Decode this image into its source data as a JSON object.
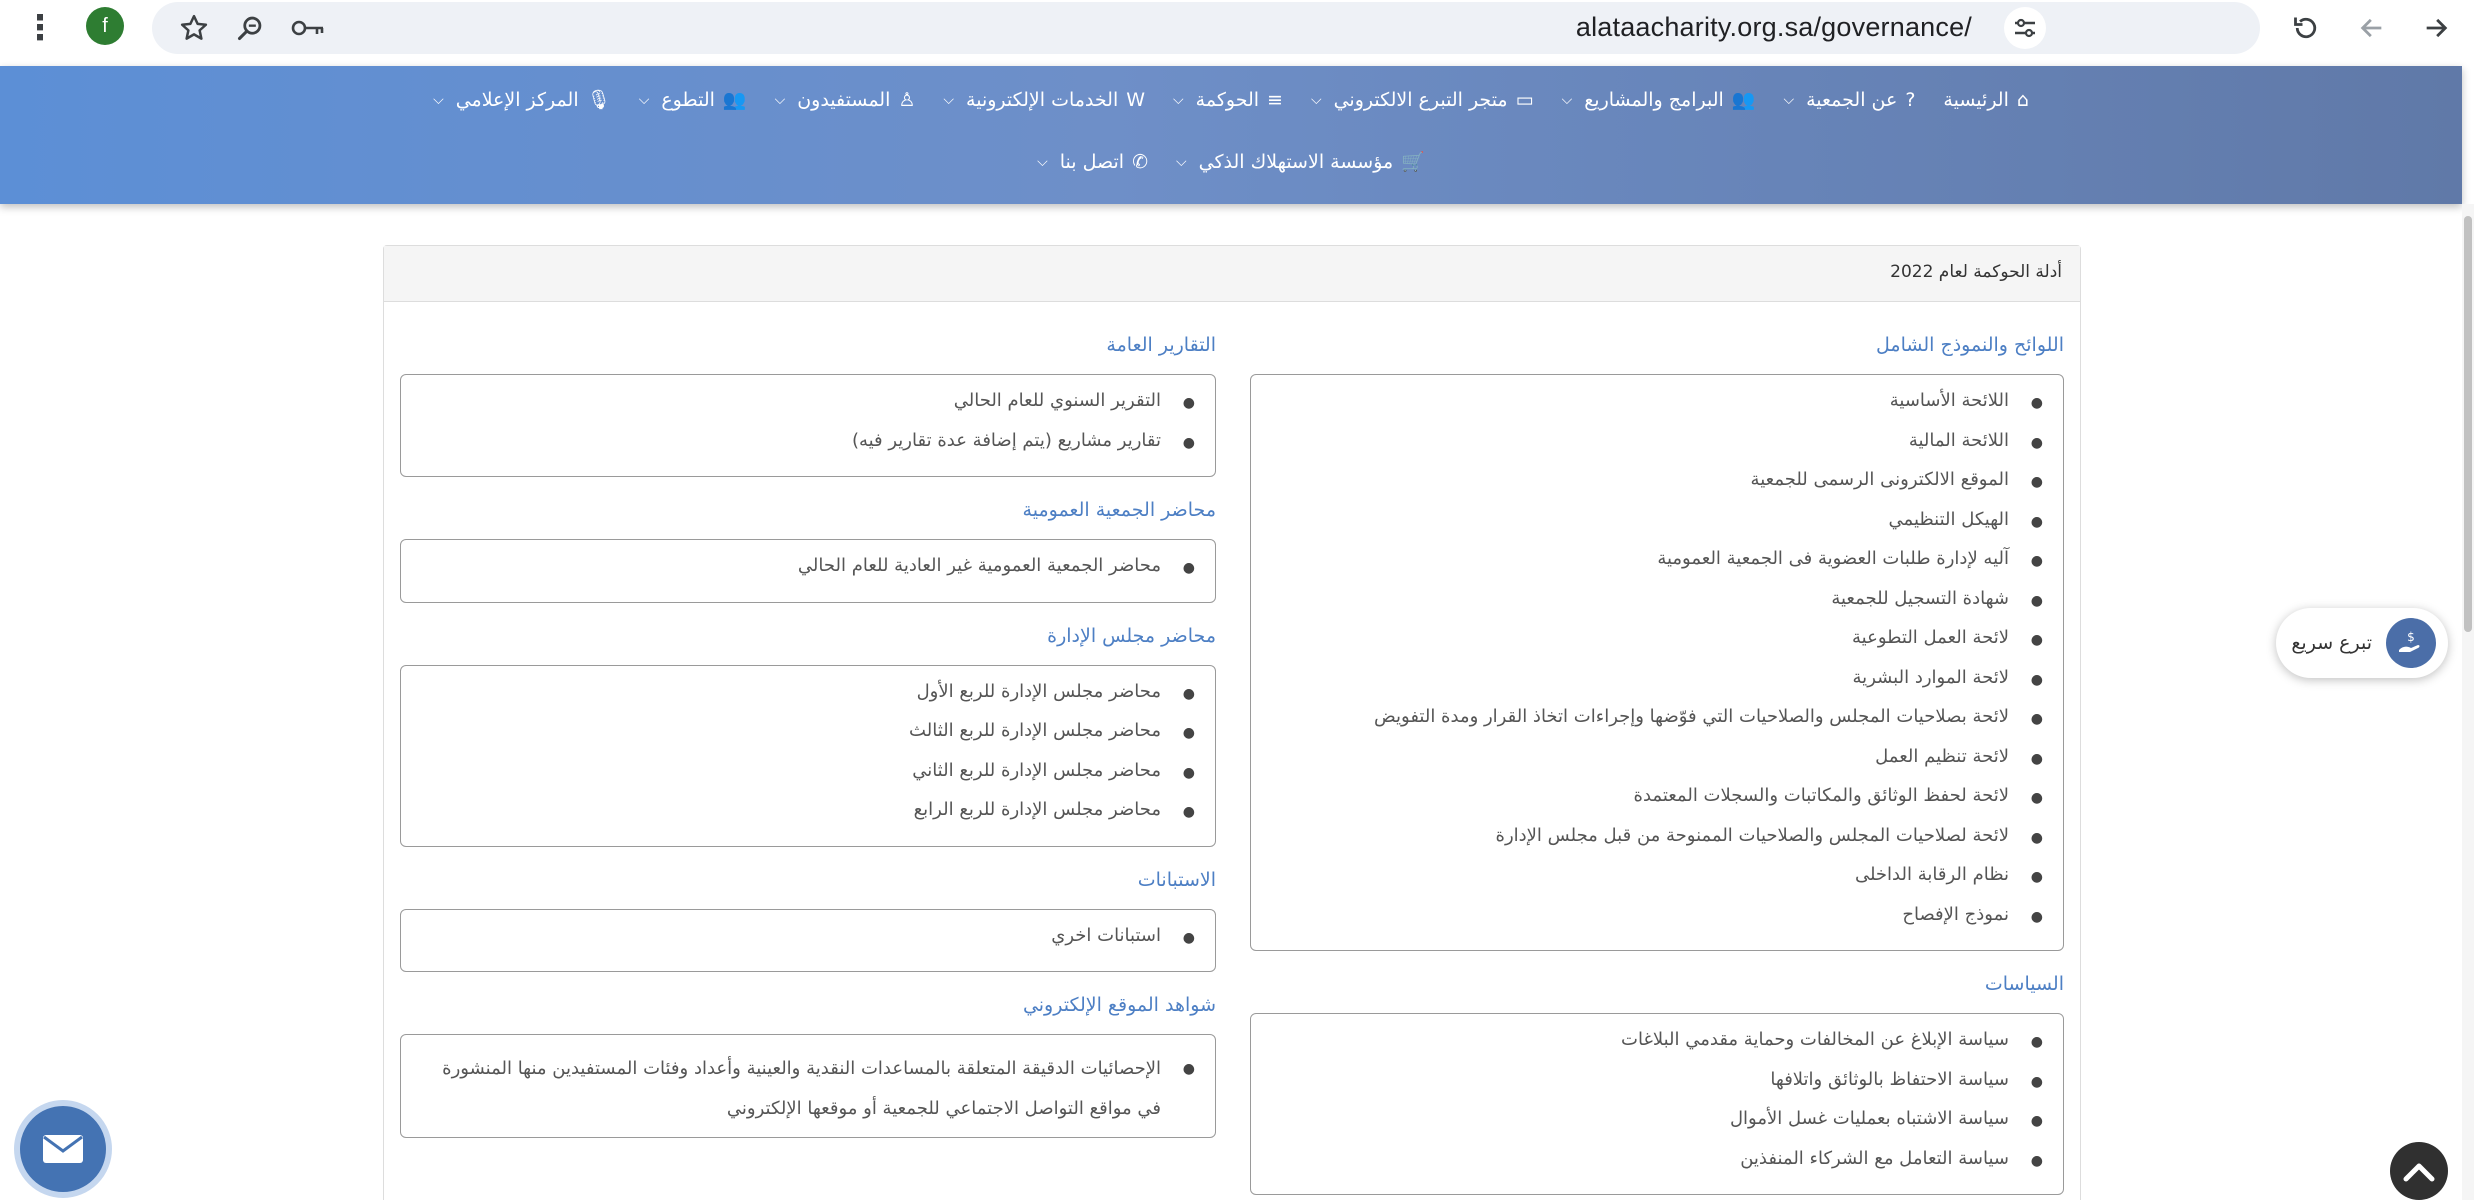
{
  "browser": {
    "url": "alataacharity.org.sa/governance/",
    "profile_initial": "f",
    "icons": [
      "more-vert-icon",
      "star-icon",
      "zoom-icon",
      "key-icon",
      "tune-icon",
      "reload-icon",
      "back-icon",
      "forward-icon"
    ]
  },
  "nav": {
    "row1": [
      {
        "label": "الرئيسية",
        "icon": "⌂",
        "dropdown": false
      },
      {
        "label": "عن الجمعية",
        "icon": "?",
        "dropdown": true
      },
      {
        "label": "البرامج والمشاريع",
        "icon": "👥",
        "dropdown": true
      },
      {
        "label": "متجر التبرع الالكتروني",
        "icon": "▭",
        "dropdown": true
      },
      {
        "label": "الحوكمة",
        "icon": "≡",
        "dropdown": true
      },
      {
        "label": "الخدمات الإلكترونية",
        "icon": "W",
        "dropdown": true
      },
      {
        "label": "المستفيدون",
        "icon": "♙",
        "dropdown": true
      },
      {
        "label": "التطوع",
        "icon": "👥",
        "dropdown": true
      },
      {
        "label": "المركز الإعلامي",
        "icon": "🎙",
        "dropdown": true
      }
    ],
    "row2": [
      {
        "label": "مؤسسة الاستهلاك الذكي",
        "icon": "🛒",
        "dropdown": true
      },
      {
        "label": "اتصل بنا",
        "icon": "✆",
        "dropdown": true
      }
    ]
  },
  "card": {
    "header": "أدلة الحوكمة لعام 2022",
    "right_column": [
      {
        "title": "اللوائح والنموذج الشامل",
        "items": [
          "اللائحة الأساسية",
          "اللائحة المالية",
          "الموقع الالكترونى الرسمى للجمعية",
          "الهيكل التنظيمي",
          "آليه لإدارة طلبات العضوية فى الجمعية العمومية",
          "شهادة التسجيل للجمعية",
          "لائحة العمل التطوعية",
          "لائحة الموارد البشرية",
          "لائحة بصلاحيات المجلس والصلاحيات التي فوّضها وإجراءات اتخاذ القرار ومدة التفويض",
          "لائحة تنظيم العمل",
          "لائحة لحفظ الوثائق والمكاتبات والسجلات المعتمدة",
          "لائحة لصلاحيات المجلس والصلاحيات الممنوحة من قبل مجلس الإدارة",
          "نظام الرقابة الداخلى",
          "نموذج الإفصاح"
        ]
      },
      {
        "title": "السياسات",
        "items": [
          "سياسة الإبلاغ عن المخالفات وحماية مقدمي البلاغات",
          "سياسة الاحتفاظ بالوثائق واتلافها",
          "سياسة الاشتباه بعمليات غسل الأموال",
          "سياسة التعامل مع الشركاء المنفذين"
        ]
      }
    ],
    "left_column": [
      {
        "title": "التقارير العامة",
        "items": [
          "التقرير السنوي للعام الحالي",
          "تقارير مشاريع (يتم إضافة عدة تقارير فيه)"
        ]
      },
      {
        "title": "محاضر الجمعية العمومية",
        "items": [
          "محاضر الجمعية العمومية غير العادية للعام الحالي"
        ]
      },
      {
        "title": "محاضر مجلس الإدارة",
        "items": [
          "محاضر مجلس الإدارة للربع الأول",
          "محاضر مجلس الإدارة للربع الثالث",
          "محاضر مجلس الإدارة للربع الثاني",
          "محاضر مجلس الإدارة للربع الرابع"
        ]
      },
      {
        "title": "الاستبانات",
        "items": [
          "استبانات اخري"
        ]
      },
      {
        "title": "شواهد الموقع الإلكتروني",
        "items": [
          "الإحصائيات الدقيقة المتعلقة بالمساعدات النقدية والعينية وأعداد وفئات المستفيدين منها المنشورة في مواقع التواصل الاجتماعي للجمعية أو موقعها الإلكتروني"
        ]
      }
    ]
  },
  "widgets": {
    "quick_donate_label": "تبرع سريع",
    "donate_icon": "hand-coin-icon",
    "mail_icon": "envelope-icon",
    "top_icon": "chevron-up-icon"
  }
}
